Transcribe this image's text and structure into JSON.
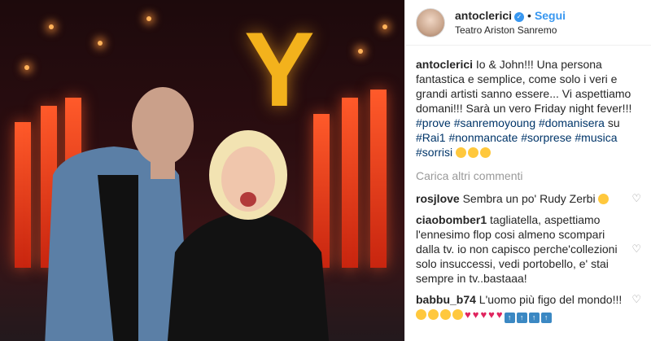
{
  "post": {
    "username": "antoclerici",
    "follow_label": "Segui",
    "location": "Teatro Ariston Sanremo",
    "caption_user": "antoclerici",
    "caption_text": "Io & John!!! Una persona fantastica e semplice, come solo i veri e grandi artisti sanno essere... Vi aspettiamo domani!!! Sarà un vero Friday night fever!!!",
    "hashtags_line1": [
      "#prove",
      "#sanremoyoung",
      "#domanisera"
    ],
    "su_word": "su",
    "hashtags_line2": [
      "#Rai1",
      "#nonmancate",
      "#sorprese",
      "#musica"
    ],
    "hashtags_line3": [
      "#sorrisi"
    ],
    "caption_emoji_count": 3
  },
  "load_more_label": "Carica altri commenti",
  "comments": [
    {
      "user": "rosjlove",
      "text": "Sembra un po' Rudy Zerbi"
    },
    {
      "user": "ciaobomber1",
      "text": "tagliatella, aspettiamo l'ennesimo flop cosi almeno scompari dalla tv. io non capisco perche'collezioni solo insuccessi, vedi portobello, e' stai sempre in tv..bastaaa!"
    },
    {
      "user": "babbu_b74",
      "text": "L'uomo più figo del mondo!!!"
    }
  ],
  "icons": {
    "verified": "verified-badge-icon",
    "heart": "heart-outline-icon"
  },
  "colors": {
    "link_blue": "#3897f0",
    "hashtag": "#003569",
    "muted": "#999999"
  }
}
